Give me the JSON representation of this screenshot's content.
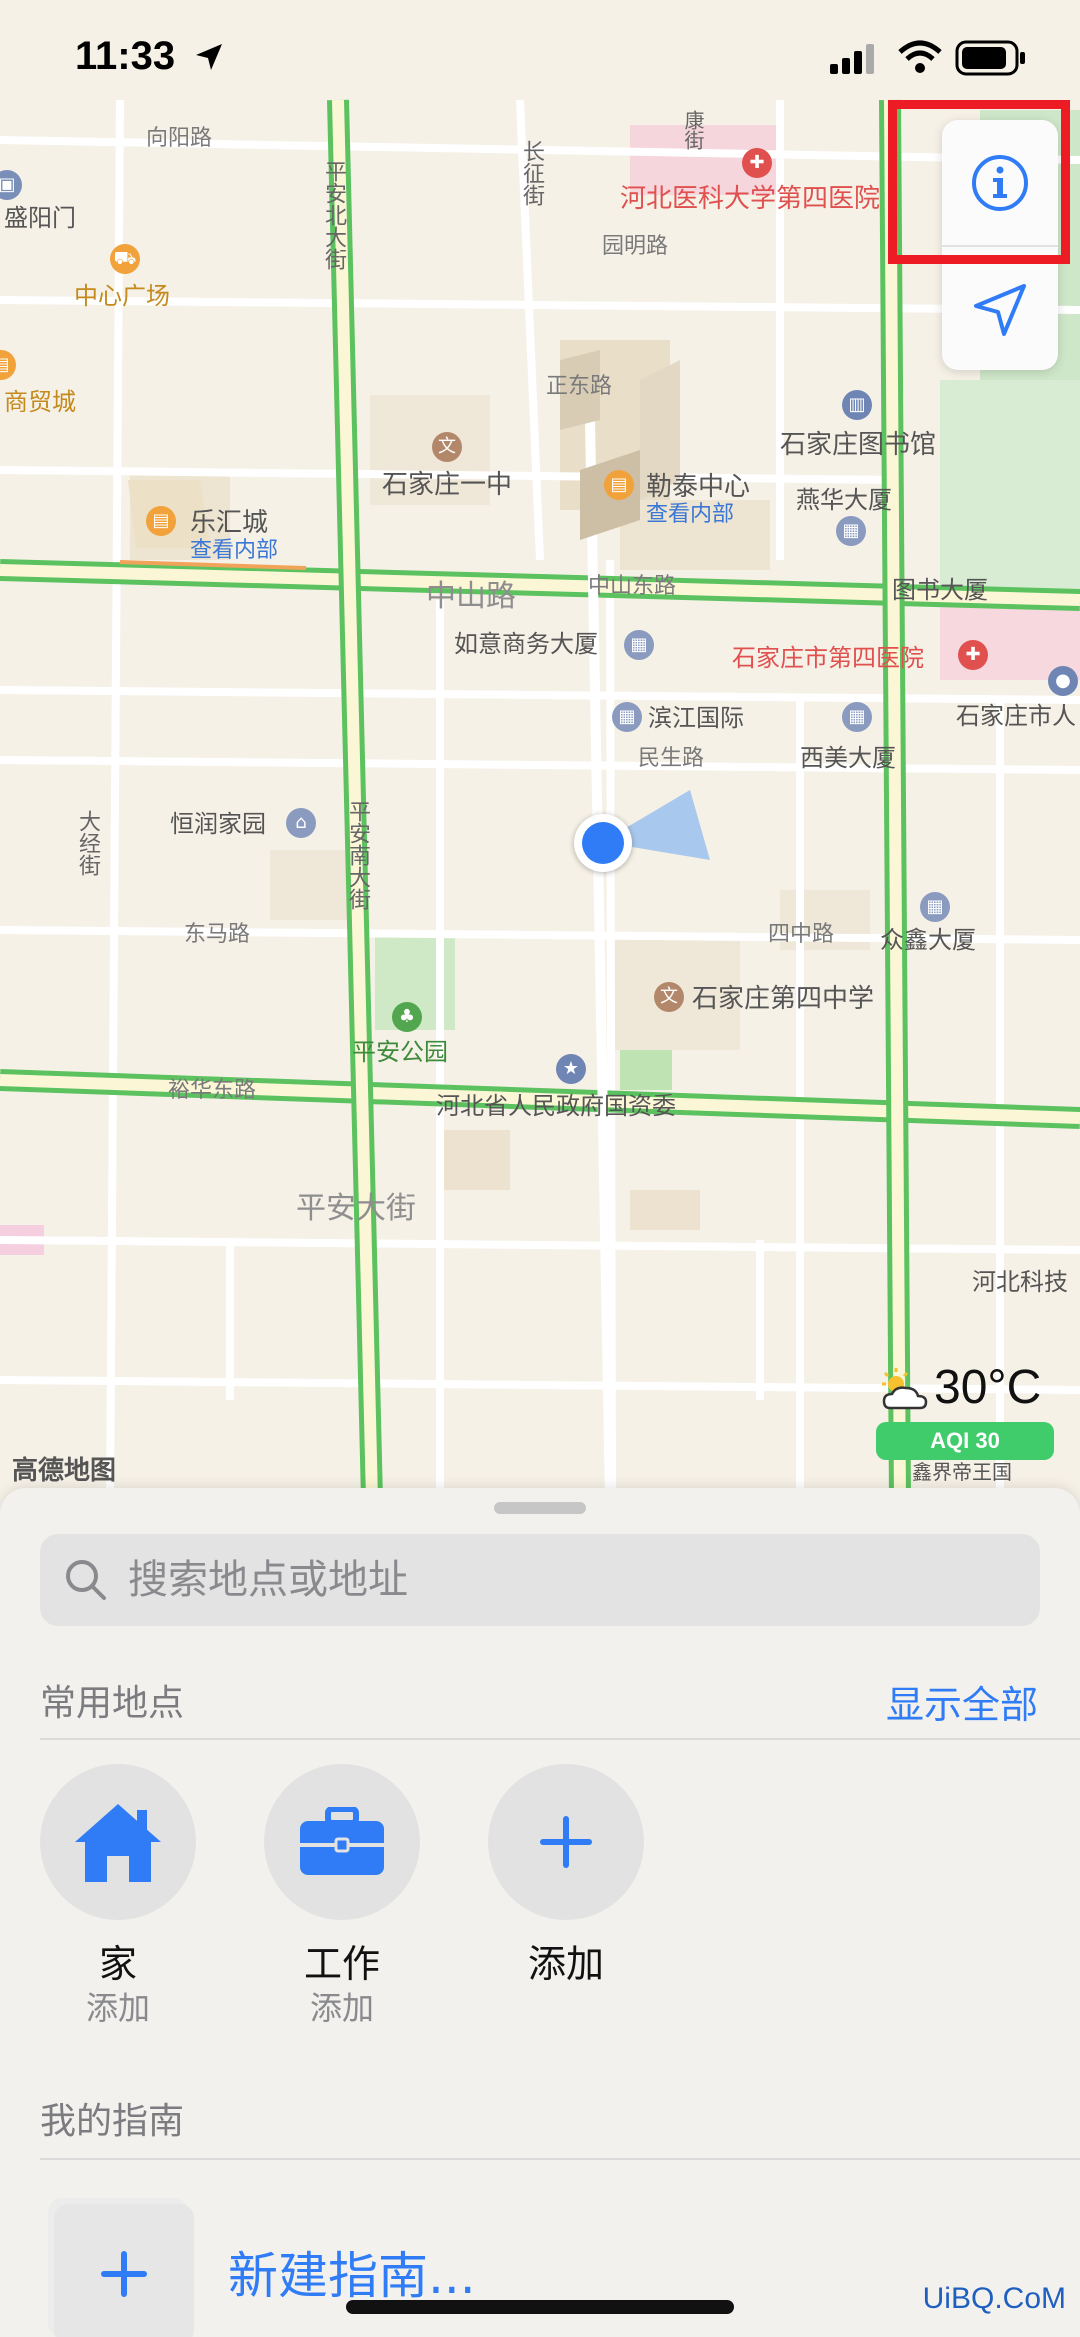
{
  "status_bar": {
    "time": "11:33"
  },
  "map": {
    "labels": {
      "xiangyang_rd": "向阳路",
      "pingan_north": "平安北大街",
      "changzheng_st": "长征街",
      "kang_st": "康街",
      "hebei_hospital": "河北医科大学第四医院",
      "shengyang_gate": "盛阳门",
      "yuanming_rd": "园明路",
      "zhongxin_square": "中心广场",
      "shangmao_city": "商贸城",
      "zhengdong_rd": "正东路",
      "sjz_library": "石家庄图书馆",
      "sjz_no1_middle": "石家庄一中",
      "letai_center": "勒泰中心",
      "letai_view": "查看内部",
      "yanhua_tower": "燕华大厦",
      "lehui_city": "乐汇城",
      "lehui_view": "查看内部",
      "zhongshan_rd": "中山路",
      "zhongshan_east": "中山东路",
      "library_tower": "图书大厦",
      "ruyi_tower": "如意商务大厦",
      "sjz_no4_hospital": "石家庄市第四医院",
      "sjz_city": "石家庄市人",
      "binjiang": "滨江国际",
      "minsheng_rd": "民生路",
      "ximei_tower": "西美大厦",
      "dajing_st": "大经街",
      "hengrun": "恒润家园",
      "pingan_south": "平安南大街",
      "dongma_rd": "东马路",
      "sizhong_rd": "四中路",
      "zhongxin_tower": "众鑫大厦",
      "sjz_no4_middle": "石家庄第四中学",
      "pingan_park": "平安公园",
      "yuhua_east": "裕华东路",
      "sasac": "河北省人民政府国资委",
      "pingan_ave": "平安大街",
      "hebei_tech": "河北科技",
      "yijie": "鑫界帝王国"
    },
    "logo": "高德地图",
    "weather": {
      "temperature": "30°C",
      "aqi": "AQI 30"
    }
  },
  "sheet": {
    "search": {
      "placeholder": "搜索地点或地址"
    },
    "favorites": {
      "title": "常用地点",
      "show_all": "显示全部",
      "items": [
        {
          "name": "家",
          "sub": "添加",
          "icon": "house-icon"
        },
        {
          "name": "工作",
          "sub": "添加",
          "icon": "briefcase-icon"
        },
        {
          "name": "添加",
          "sub": "",
          "icon": "plus-icon"
        }
      ]
    },
    "guides": {
      "title": "我的指南",
      "new_guide": "新建指南..."
    }
  },
  "watermark": "UiBQ.CoM",
  "colors": {
    "accent_blue": "#2f7cf6",
    "highlight_red": "#ec1b24",
    "road_green": "#5bc25f",
    "aqi_green": "#41cc6b",
    "user_location": "#2f7cf6"
  }
}
